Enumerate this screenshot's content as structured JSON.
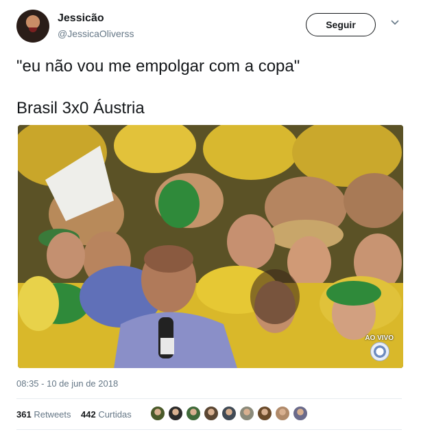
{
  "user": {
    "name": "Jessicão",
    "handle": "@JessicaOliverss",
    "follow_label": "Seguir"
  },
  "tweet": {
    "line1": "\"eu não vou me empolgar com a copa\"",
    "line2": "Brasil 3x0 Áustria"
  },
  "media": {
    "live_label": "AO VIVO",
    "logo_icon": "tv-globo-logo"
  },
  "timestamp": "08:35 - 10 de jun de 2018",
  "stats": {
    "retweets_count": "361",
    "retweets_label": "Retweets",
    "likes_count": "442",
    "likes_label": "Curtidas"
  },
  "likers": [
    {
      "color": "#4a5a2a"
    },
    {
      "color": "#2b2b2b"
    },
    {
      "color": "#3f6a3a"
    },
    {
      "color": "#5a4632"
    },
    {
      "color": "#404a55"
    },
    {
      "color": "#8a8a7a"
    },
    {
      "color": "#6a4a2a"
    },
    {
      "color": "#b08a6a"
    },
    {
      "color": "#6a6a8a"
    }
  ],
  "colors": {
    "text_primary": "#14171a",
    "text_secondary": "#657786",
    "divider": "#e6ecf0",
    "crowd_yellow": "#e8c42a",
    "crowd_green": "#2f8a3a"
  }
}
